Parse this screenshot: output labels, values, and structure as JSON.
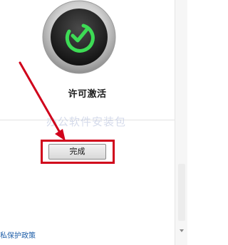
{
  "license": {
    "icon": "license-check-icon",
    "title": "许可激活"
  },
  "watermark": "办公软件安装包",
  "actions": {
    "finish_label": "完成"
  },
  "footer": {
    "privacy_link": "私保护政策"
  },
  "colors": {
    "accent_red": "#d0021b",
    "check_green": "#3ddc55",
    "link_blue": "#1e5ea8"
  }
}
